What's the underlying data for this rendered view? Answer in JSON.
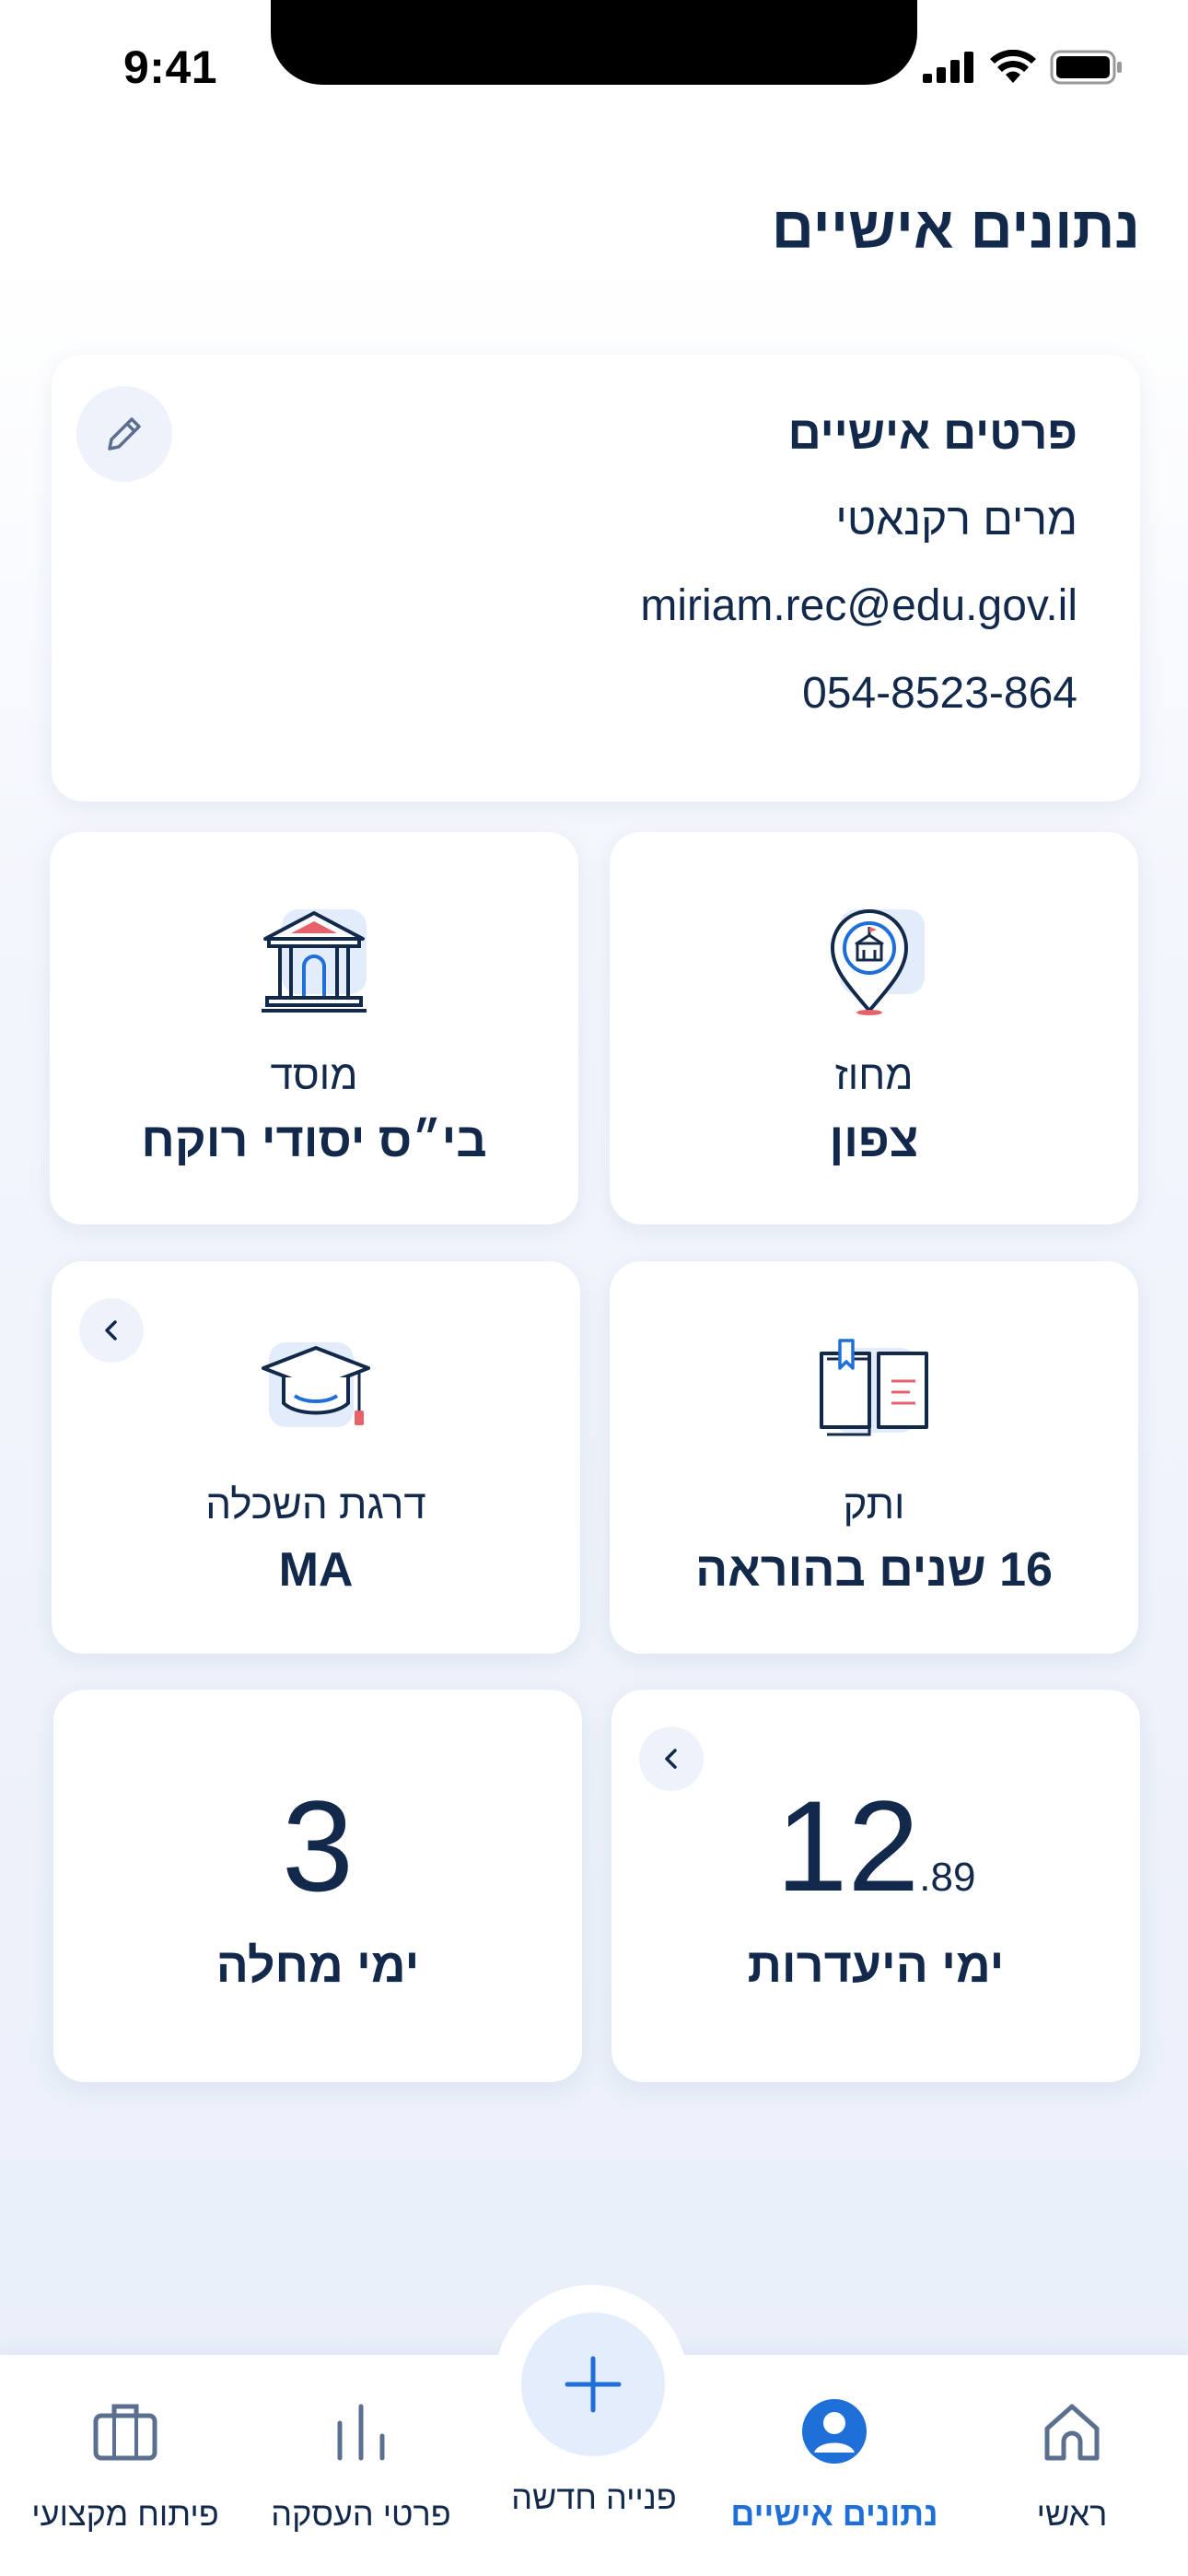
{
  "status_bar": {
    "time": "9:41"
  },
  "page": {
    "title": "נתונים אישיים"
  },
  "personal_details": {
    "heading": "פרטים אישיים",
    "name": "מרים רקנאטי",
    "email": "miriam.rec@edu.gov.il",
    "phone": "054-8523-864",
    "edit_icon": "pencil-icon"
  },
  "tiles": {
    "district": {
      "label": "מחוז",
      "value": "צפון",
      "icon": "location-pin-school-icon"
    },
    "institution": {
      "label": "מוסד",
      "value": "בי״ס יסודי רוקח",
      "icon": "institution-building-icon"
    },
    "seniority": {
      "label": "ותק",
      "value": "16 שנים בהוראה",
      "icon": "open-book-icon"
    },
    "education": {
      "label": "דרגת השכלה",
      "value": "MA",
      "icon": "graduation-cap-icon"
    },
    "absence_days": {
      "whole": "12",
      "fraction": ".89",
      "label": "ימי היעדרות"
    },
    "sick_days": {
      "value": "3",
      "label": "ימי מחלה"
    }
  },
  "tab_bar": {
    "home": "ראשי",
    "personal": "נתונים אישיים",
    "new_request": "פנייה חדשה",
    "employment": "פרטי העסקה",
    "development": "פיתוח מקצועי"
  },
  "colors": {
    "primary_text": "#13294b",
    "accent": "#1f6fd8",
    "icon_bg": "#eef3fb",
    "highlight_red": "#e8606a"
  }
}
